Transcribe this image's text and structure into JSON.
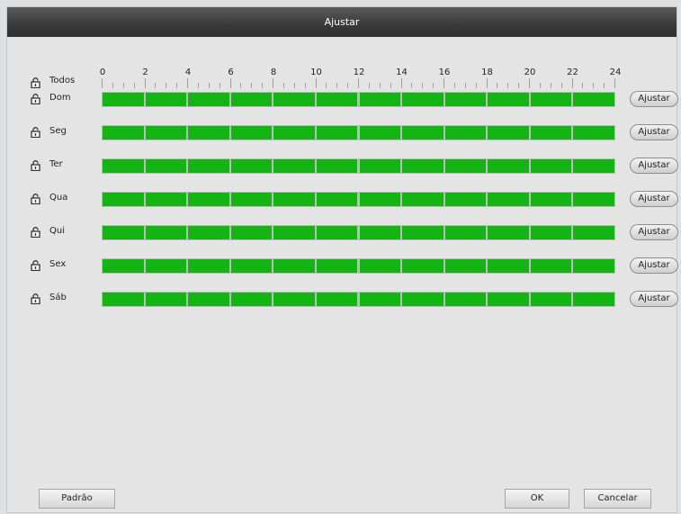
{
  "dialog": {
    "title": "Ajustar"
  },
  "all_row": {
    "label": "Todos"
  },
  "ruler": {
    "hours": [
      "0",
      "2",
      "4",
      "6",
      "8",
      "10",
      "12",
      "14",
      "16",
      "18",
      "20",
      "22",
      "24"
    ]
  },
  "days": [
    {
      "label": "Dom",
      "button": "Ajustar"
    },
    {
      "label": "Seg",
      "button": "Ajustar"
    },
    {
      "label": "Ter",
      "button": "Ajustar"
    },
    {
      "label": "Qua",
      "button": "Ajustar"
    },
    {
      "label": "Qui",
      "button": "Ajustar"
    },
    {
      "label": "Sex",
      "button": "Ajustar"
    },
    {
      "label": "Sáb",
      "button": "Ajustar"
    }
  ],
  "footer": {
    "default_label": "Padrão",
    "ok_label": "OK",
    "cancel_label": "Cancelar"
  },
  "colors": {
    "schedule_fill": "#13b413",
    "titlebar": "#3a3a3a"
  },
  "icons": {
    "lock": "unlock-icon"
  }
}
